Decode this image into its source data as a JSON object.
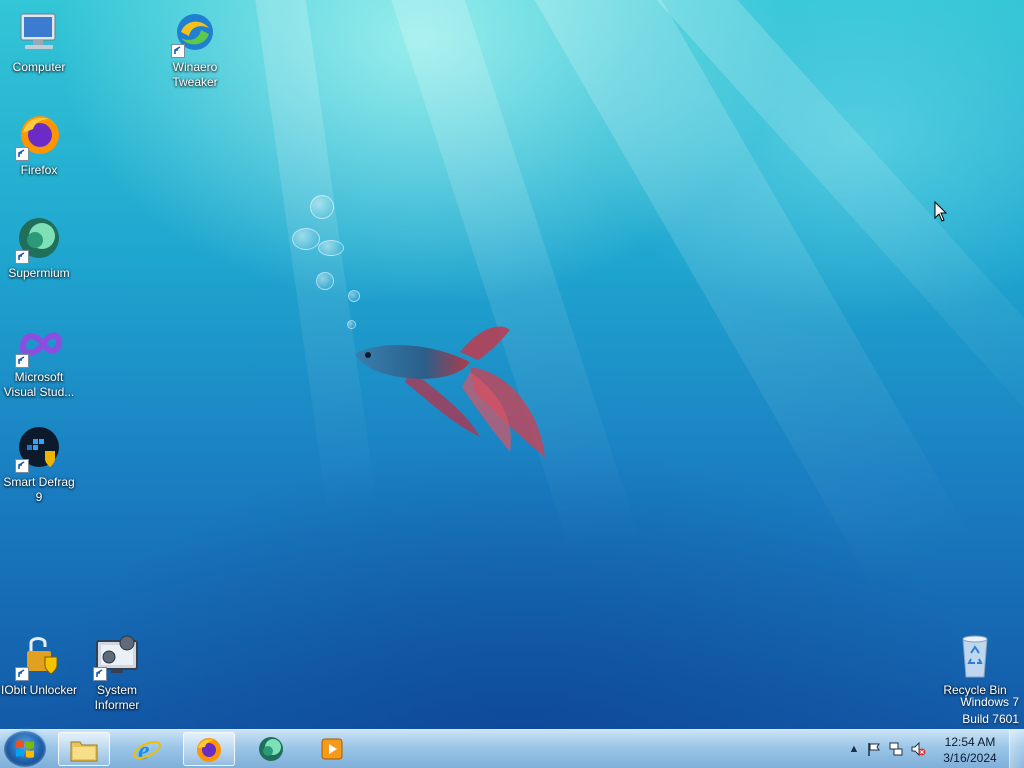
{
  "desktop": {
    "icons": {
      "computer": {
        "label": "Computer",
        "icon": "computer-icon"
      },
      "winaero": {
        "label": "Winaero Tweaker",
        "icon": "winaero-tweaker-icon"
      },
      "firefox": {
        "label": "Firefox",
        "icon": "firefox-icon"
      },
      "supermium": {
        "label": "Supermium",
        "icon": "supermium-icon"
      },
      "vstudio": {
        "label": "Microsoft Visual Stud...",
        "icon": "visual-studio-icon"
      },
      "smartdefrag": {
        "label": "Smart Defrag 9",
        "icon": "smart-defrag-icon"
      },
      "iobit": {
        "label": "IObit Unlocker",
        "icon": "iobit-unlocker-icon"
      },
      "sysinformer": {
        "label": "System Informer",
        "icon": "system-informer-icon"
      },
      "recycle": {
        "label": "Recycle Bin",
        "icon": "recycle-bin-icon"
      }
    },
    "watermark": {
      "line1": "Windows 7",
      "line2": "Build 7601"
    }
  },
  "taskbar": {
    "start_icon": "windows-orb-icon",
    "pinned": [
      {
        "name": "File Explorer",
        "icon": "folder-icon",
        "active": true
      },
      {
        "name": "Internet Explorer",
        "icon": "internet-explorer-icon",
        "active": false
      },
      {
        "name": "Firefox",
        "icon": "firefox-icon",
        "active": true
      },
      {
        "name": "Supermium",
        "icon": "supermium-icon",
        "active": false
      },
      {
        "name": "Media Player",
        "icon": "media-player-icon",
        "active": false
      }
    ],
    "tray": {
      "icons": [
        "show-hidden-icons",
        "action-center-flag-icon",
        "network-icon",
        "volume-muted-icon"
      ],
      "time": "12:54 AM",
      "date": "3/16/2024"
    }
  },
  "colors": {
    "accent": "#1a7fc2",
    "taskbar": "#9cc3e6"
  }
}
